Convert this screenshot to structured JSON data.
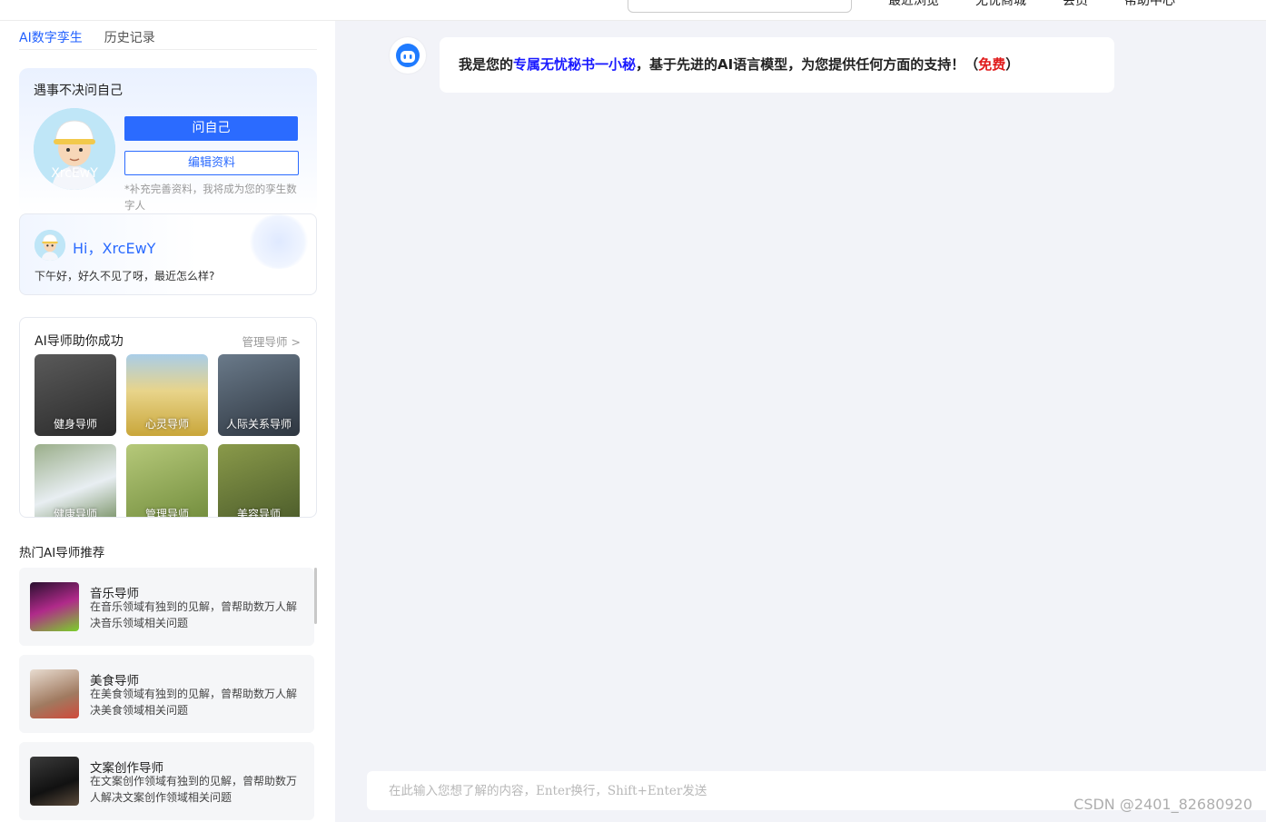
{
  "topbar": {
    "nav": [
      "最近浏览",
      "无忧商城",
      "会员",
      "帮助中心"
    ]
  },
  "sidebar": {
    "tabs": [
      "AI数字孪生",
      "历史记录"
    ],
    "profile": {
      "title": "遇事不决问自己",
      "avatar_name": "XrcEwY",
      "ask_button": "问自己",
      "edit_button": "编辑资料",
      "hint": "*补充完善资料，我将成为您的孪生数字人"
    },
    "greeting": {
      "hi": "Hi，XrcEwY",
      "message": "下午好，好久不见了呀，最近怎么样?"
    },
    "mentors": {
      "title": "AI导师助你成功",
      "manage": "管理导师 >",
      "items": [
        {
          "label": "健身导师",
          "icon": "mentor-fitness-photo",
          "color": "#3a3a3a"
        },
        {
          "label": "心灵导师",
          "icon": "mentor-spirit-photo",
          "color": "#d9b84a"
        },
        {
          "label": "人际关系导师",
          "icon": "mentor-relations-photo",
          "color": "#4a5a6a"
        },
        {
          "label": "健康导师",
          "icon": "mentor-health-photo",
          "color": "#6f8a5a"
        },
        {
          "label": "管理导师",
          "icon": "mentor-manage-photo",
          "color": "#8aa35a"
        },
        {
          "label": "美容导师",
          "icon": "mentor-beauty-photo",
          "color": "#7a8a4a"
        }
      ]
    },
    "hot": {
      "title": "热门AI导师推荐",
      "items": [
        {
          "name": "音乐导师",
          "desc": "在音乐领域有独到的见解，曾帮助数万人解决音乐领域相关问题",
          "color": "#6a2a7a"
        },
        {
          "name": "美食导师",
          "desc": "在美食领域有独到的见解，曾帮助数万人解决美食领域相关问题",
          "color": "#c8a890"
        },
        {
          "name": "文案创作导师",
          "desc": "在文案创作领域有独到的见解，曾帮助数万人解决文案创作领域相关问题",
          "color": "#2a2a2a"
        }
      ]
    }
  },
  "chat": {
    "message_prefix": "我是您的",
    "message_highlight": "专属无忧秘书一小秘",
    "message_middle": "，基于先进的AI语言模型，为您提供任何方面的支持！",
    "message_paren_open": "（",
    "message_free": "免费",
    "message_paren_close": "）"
  },
  "input": {
    "placeholder": "在此输入您想了解的内容，Enter换行，Shift+Enter发送"
  },
  "watermark": "CSDN @2401_82680920"
}
